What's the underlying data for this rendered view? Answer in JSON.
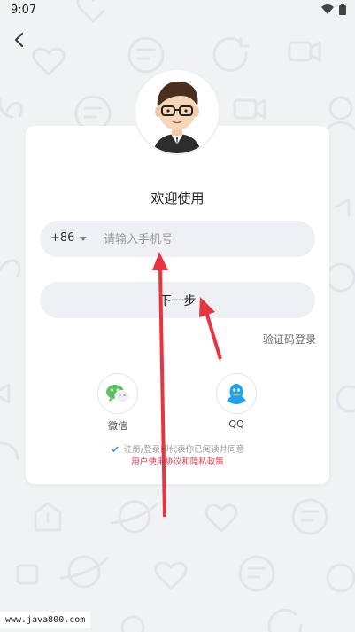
{
  "status_bar": {
    "time": "9:07"
  },
  "welcome_title": "欢迎使用",
  "phone": {
    "country_code": "+86",
    "placeholder": "请输入手机号"
  },
  "next_button_label": "下一步",
  "sms_login_link": "验证码登录",
  "social": {
    "wechat_label": "微信",
    "qq_label": "QQ"
  },
  "agreement": {
    "text": "注册/登录即代表你已阅读并同意",
    "user_agreement": "用户使用协议",
    "and": "和",
    "privacy_policy": "隐私政策"
  },
  "watermark": "www.java800.com",
  "colors": {
    "accent_red": "#e8364b",
    "wechat_green": "#5dc261",
    "qq_blue": "#1fa3f0",
    "annotation_arrow": "#e8343f"
  },
  "icons": [
    "back-arrow-icon",
    "wifi-icon",
    "battery-icon",
    "wechat-icon",
    "qq-icon",
    "checkbox-icon"
  ]
}
